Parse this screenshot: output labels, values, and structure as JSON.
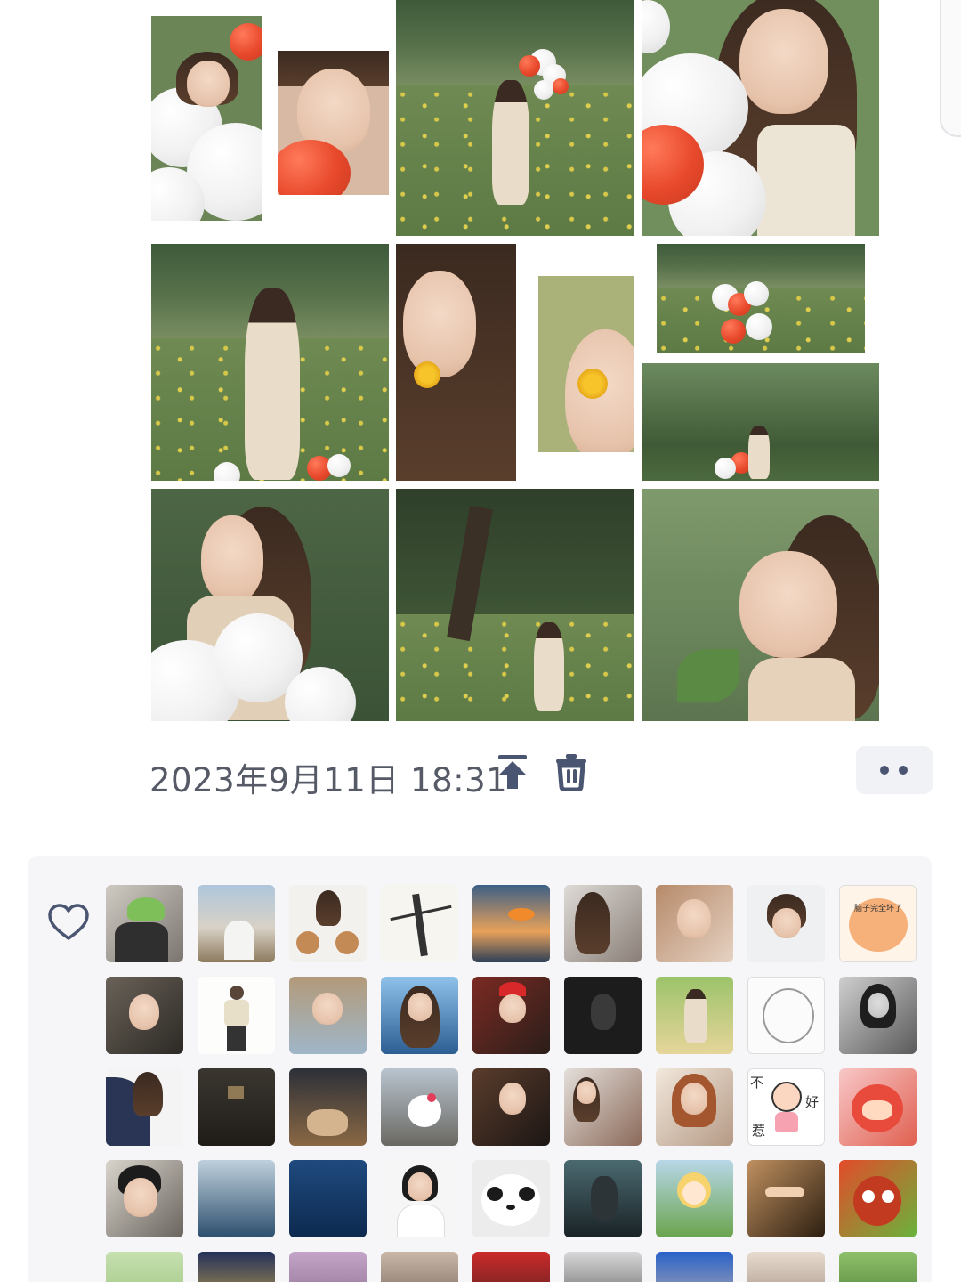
{
  "moment": {
    "timestamp": "2023年9月11日 18:31",
    "actions": {
      "pin_icon": "pin-top-icon",
      "delete_icon": "trash-icon",
      "more_icon": "more-dots-icon"
    },
    "photos_count": 9
  },
  "likes": {
    "icon": "heart-outline-icon",
    "accent_color": "#4a5572",
    "avatar_text": {
      "sticker_1": "脑子完全坏了",
      "sticker_2_top": "不",
      "sticker_2_right": "好",
      "sticker_2_bottom": "惹"
    }
  }
}
